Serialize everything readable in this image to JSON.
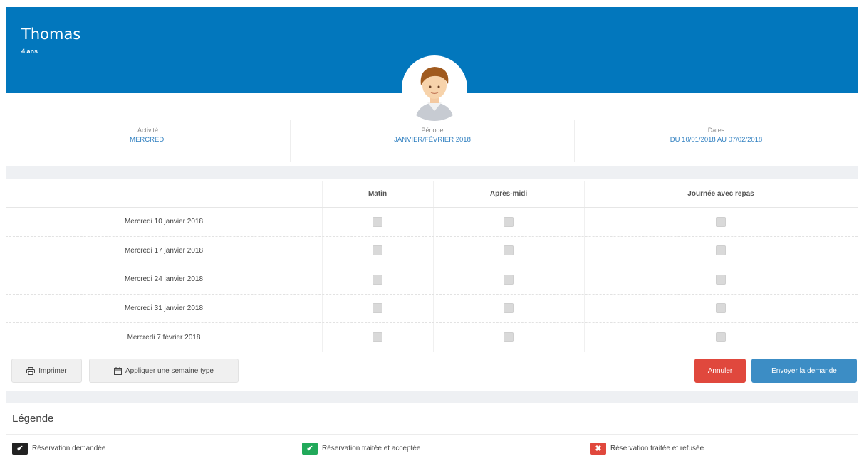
{
  "child": {
    "name": "Thomas",
    "age": "4 ans"
  },
  "info": {
    "activity_label": "Activité",
    "activity_value": "MERCREDI",
    "period_label": "Période",
    "period_value": "JANVIER/FÉVRIER 2018",
    "dates_label": "Dates",
    "dates_value": "DU 10/01/2018 AU 07/02/2018"
  },
  "table": {
    "columns": [
      "Matin",
      "Après-midi",
      "Journée avec repas"
    ],
    "rows": [
      "Mercredi 10 janvier 2018",
      "Mercredi 17 janvier 2018",
      "Mercredi 24 janvier 2018",
      "Mercredi 31 janvier 2018",
      "Mercredi 7 février 2018"
    ]
  },
  "actions": {
    "print": "Imprimer",
    "apply_week": "Appliquer une semaine type",
    "cancel": "Annuler",
    "send": "Envoyer la demande"
  },
  "legend": {
    "title": "Légende",
    "items": [
      {
        "label": "Réservation demandée",
        "color": "#222222",
        "icon": "check-icon"
      },
      {
        "label": "Réservation traitée et acceptée",
        "color": "#21a95a",
        "icon": "check-icon"
      },
      {
        "label": "Réservation traitée et refusée",
        "color": "#e0483d",
        "icon": "x-icon"
      }
    ]
  },
  "colors": {
    "header": "#0277bd",
    "link": "#2f7fc0",
    "cancel": "#e0483d",
    "send": "#3c8dc5"
  }
}
